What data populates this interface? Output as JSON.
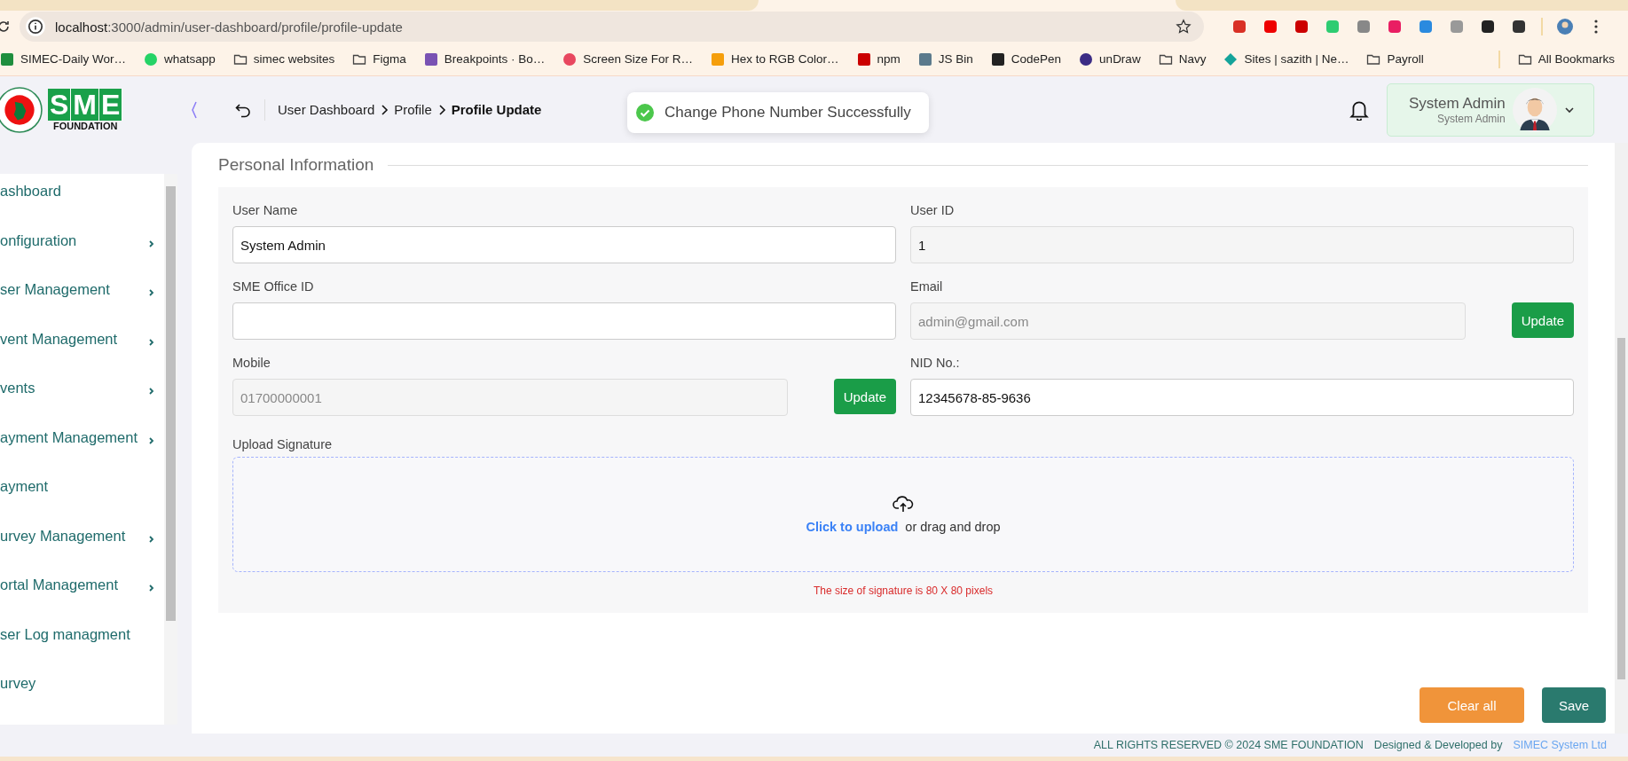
{
  "browser": {
    "url_host": "localhost",
    "url_path": ":3000/admin/user-dashboard/profile/profile-update",
    "bookmarks": [
      {
        "label": "SIMEC-Daily Wor…"
      },
      {
        "label": "whatsapp"
      },
      {
        "label": "simec websites"
      },
      {
        "label": "Figma"
      },
      {
        "label": "Breakpoints · Bo…"
      },
      {
        "label": "Screen Size For R…"
      },
      {
        "label": "Hex to RGB Color…"
      },
      {
        "label": "npm"
      },
      {
        "label": "JS Bin"
      },
      {
        "label": "CodePen"
      },
      {
        "label": "unDraw"
      },
      {
        "label": "Navy"
      },
      {
        "label": "Sites | sazith | Ne…"
      },
      {
        "label": "Payroll"
      }
    ],
    "all_bookmarks": "All Bookmarks"
  },
  "logo": {
    "letters": [
      "S",
      "M",
      "E"
    ],
    "subtitle": "FOUNDATION"
  },
  "breadcrumb": [
    {
      "label": "User Dashboard",
      "current": false
    },
    {
      "label": "Profile",
      "current": false
    },
    {
      "label": "Profile Update",
      "current": true
    }
  ],
  "toast": {
    "message": "Change Phone Number Successfully"
  },
  "user": {
    "name": "System Admin",
    "role": "System Admin"
  },
  "sidebar": {
    "items": [
      {
        "label": "ashboard",
        "has_submenu": false
      },
      {
        "label": "onfiguration",
        "has_submenu": true
      },
      {
        "label": "ser Management",
        "has_submenu": true
      },
      {
        "label": "vent Management",
        "has_submenu": true
      },
      {
        "label": "vents",
        "has_submenu": true
      },
      {
        "label": "ayment Management",
        "has_submenu": true
      },
      {
        "label": "ayment",
        "has_submenu": false
      },
      {
        "label": "urvey Management",
        "has_submenu": true
      },
      {
        "label": "ortal Management",
        "has_submenu": true
      },
      {
        "label": "ser Log managment",
        "has_submenu": false
      },
      {
        "label": "urvey",
        "has_submenu": false
      }
    ]
  },
  "form": {
    "section_title": "Personal Information",
    "fields": [
      {
        "label": "User Name",
        "value": "System Admin",
        "kind": "editable"
      },
      {
        "label": "User ID",
        "value": "1",
        "kind": "readonly"
      },
      {
        "label": "SME Office ID",
        "kind": "editable"
      },
      {
        "label": "Email",
        "value": "admin@gmail.com",
        "kind": "disabled",
        "button": "Update"
      },
      {
        "label": "Mobile",
        "value": "01700000001",
        "kind": "disabled",
        "button": "Update"
      },
      {
        "label": "NID No.:",
        "value": "12345678-85-9636",
        "kind": "editable"
      }
    ],
    "upload": {
      "label": "Upload Signature",
      "link": "Click to upload",
      "text": "or drag and drop",
      "note": "The size of signature is 80 X 80 pixels"
    },
    "buttons": [
      {
        "label": "Clear all",
        "kind": "secondary"
      },
      {
        "label": "Save",
        "kind": "primary"
      }
    ]
  },
  "footer": {
    "copyright": "ALL RIGHTS RESERVED © 2024 SME FOUNDATION",
    "credit": "Designed & Developed by",
    "company": "SIMEC System Ltd"
  }
}
